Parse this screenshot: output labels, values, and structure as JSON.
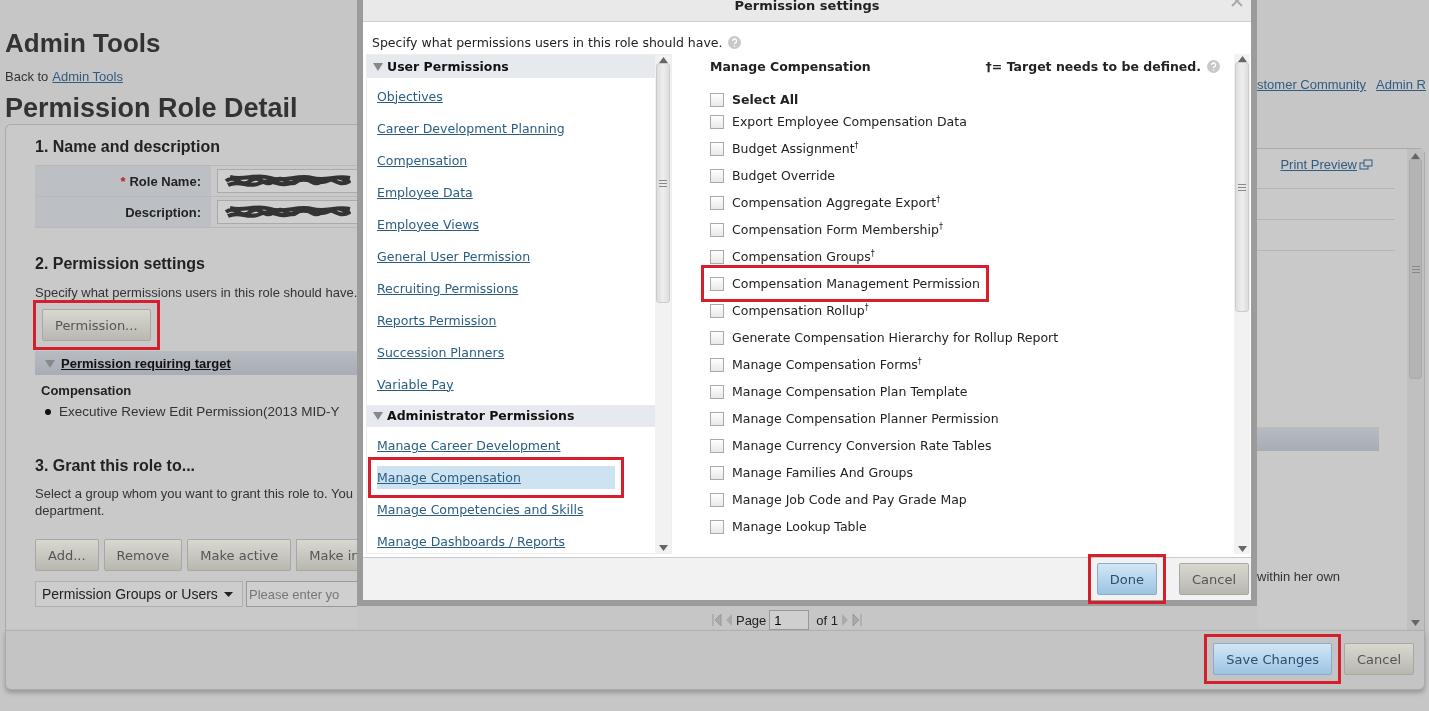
{
  "page": {
    "title": "Admin Tools",
    "breadcrumb_prefix": "Back to",
    "breadcrumb_link": "Admin Tools",
    "top_links": [
      "stomer Community",
      "Admin R"
    ],
    "heading": "Permission Role Detail",
    "print_preview": "Print Preview"
  },
  "section1": {
    "title": "1. Name and description",
    "fields": [
      {
        "label": "Role Name:",
        "required": true,
        "required_mark": "*"
      },
      {
        "label": "Description:",
        "required": false
      }
    ]
  },
  "section2": {
    "title": "2. Permission settings",
    "text": "Specify what permissions users in this role should have.",
    "button": {
      "label": "Permission...",
      "highlighted": true
    },
    "target_bar": {
      "label": "Permission requiring target",
      "expanded": true
    },
    "group": "Compensation",
    "items": [
      "Executive Review Edit Permission(2013 MID-Y"
    ]
  },
  "section3": {
    "title": "3. Grant this role to...",
    "text": "Select a group whom you want to grant this role to. You",
    "text_line2": "department.",
    "text_right": "within her own",
    "buttons": [
      "Add...",
      "Remove",
      "Make active",
      "Make in"
    ],
    "dropdown": "Permission Groups or Users",
    "placeholder": "Please enter yo"
  },
  "pager": {
    "label": "Page",
    "value": "1",
    "of": "of 1"
  },
  "footer_buttons": [
    {
      "label": "Save Changes",
      "primary": true,
      "highlighted": true
    },
    {
      "label": "Cancel",
      "primary": false,
      "highlighted": false
    }
  ],
  "dialog": {
    "title": "Permission settings",
    "intro": "Specify what permissions users in this role should have.",
    "groups": [
      {
        "title": "User Permissions",
        "expanded": true,
        "items": [
          {
            "label": "Objectives",
            "selected": false,
            "highlighted": false
          },
          {
            "label": "Career Development Planning",
            "selected": false,
            "highlighted": false
          },
          {
            "label": "Compensation",
            "selected": false,
            "highlighted": false
          },
          {
            "label": "Employee Data",
            "selected": false,
            "highlighted": false
          },
          {
            "label": "Employee Views",
            "selected": false,
            "highlighted": false
          },
          {
            "label": "General User Permission",
            "selected": false,
            "highlighted": false
          },
          {
            "label": "Recruiting Permissions",
            "selected": false,
            "highlighted": false
          },
          {
            "label": "Reports Permission",
            "selected": false,
            "highlighted": false
          },
          {
            "label": "Succession Planners",
            "selected": false,
            "highlighted": false
          },
          {
            "label": "Variable Pay",
            "selected": false,
            "highlighted": false
          }
        ]
      },
      {
        "title": "Administrator Permissions",
        "expanded": true,
        "items": [
          {
            "label": "Manage Career Development",
            "selected": false,
            "highlighted": false
          },
          {
            "label": "Manage Compensation",
            "selected": true,
            "highlighted": true
          },
          {
            "label": "Manage Competencies and Skills",
            "selected": false,
            "highlighted": false
          },
          {
            "label": "Manage Dashboards / Reports",
            "selected": false,
            "highlighted": false
          }
        ]
      }
    ],
    "panel_title": "Manage Compensation",
    "legend": "†= Target needs to be defined.",
    "permissions": [
      {
        "label": "Select All",
        "kind": "select-all",
        "checked": false,
        "highlighted": false
      },
      {
        "label": "Export Employee Compensation Data",
        "kind": "permission",
        "checked": false,
        "highlighted": false
      },
      {
        "label": "Budget Assignment$^{†}$",
        "kind": "permission",
        "checked": false,
        "highlighted": false
      },
      {
        "label": "Budget Override",
        "kind": "permission",
        "checked": false,
        "highlighted": false
      },
      {
        "label": "Compensation Aggregate Export$^{†}$",
        "kind": "permission",
        "checked": false,
        "highlighted": false
      },
      {
        "label": "Compensation Form Membership$^{†}$",
        "kind": "permission",
        "checked": false,
        "highlighted": false
      },
      {
        "label": "Compensation Groups$^{†}$",
        "kind": "permission",
        "checked": false,
        "highlighted": false
      },
      {
        "label": "Compensation Management Permission",
        "kind": "permission",
        "checked": false,
        "highlighted": true
      },
      {
        "label": "Compensation Rollup$^{†}$",
        "kind": "permission",
        "checked": false,
        "highlighted": false
      },
      {
        "label": "Generate Compensation Hierarchy for Rollup Report",
        "kind": "permission",
        "checked": false,
        "highlighted": false
      },
      {
        "label": "Manage Compensation Forms$^{†}$",
        "kind": "permission",
        "checked": false,
        "highlighted": false
      },
      {
        "label": "Manage Compensation Plan Template",
        "kind": "permission",
        "checked": false,
        "highlighted": false
      },
      {
        "label": "Manage Compensation Planner Permission",
        "kind": "permission",
        "checked": false,
        "highlighted": false
      },
      {
        "label": "Manage Currency Conversion Rate Tables",
        "kind": "permission",
        "checked": false,
        "highlighted": false
      },
      {
        "label": "Manage Families And Groups",
        "kind": "permission",
        "checked": false,
        "highlighted": false
      },
      {
        "label": "Manage Job Code and Pay Grade Map",
        "kind": "permission",
        "checked": false,
        "highlighted": false
      },
      {
        "label": "Manage Lookup Table",
        "kind": "permission",
        "checked": false,
        "highlighted": false
      }
    ],
    "buttons": [
      {
        "label": "Done",
        "primary": true,
        "highlighted": true
      },
      {
        "label": "Cancel",
        "primary": false,
        "highlighted": false
      }
    ]
  }
}
